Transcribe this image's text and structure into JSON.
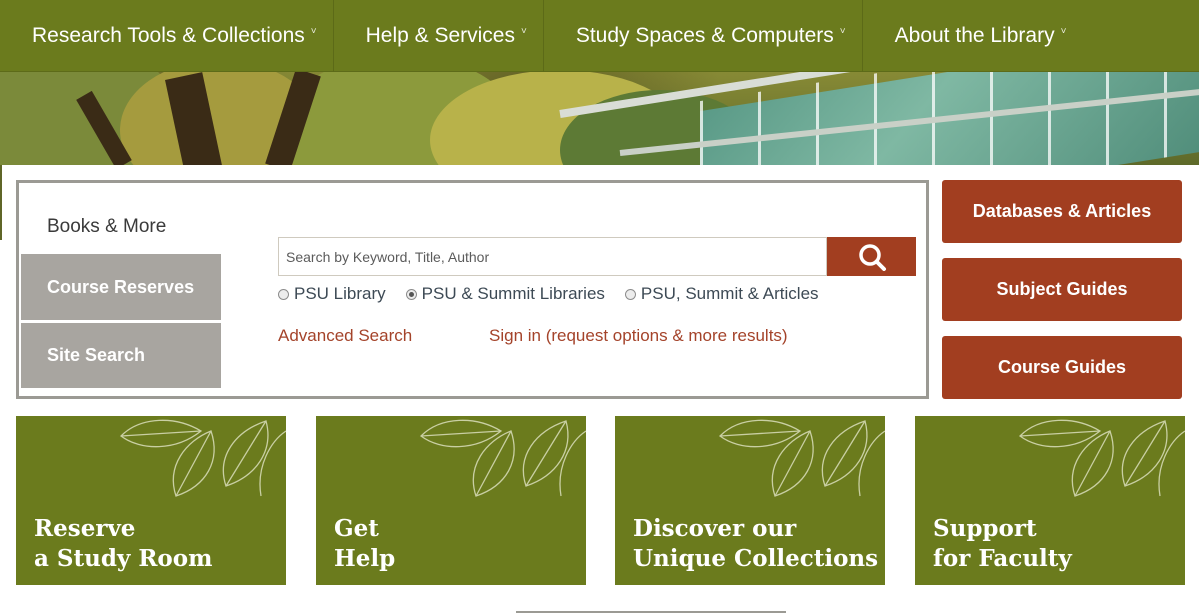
{
  "nav": {
    "items": [
      {
        "label": "Research Tools & Collections"
      },
      {
        "label": "Help & Services"
      },
      {
        "label": "Study Spaces & Computers"
      },
      {
        "label": "About the Library"
      }
    ],
    "caret": "˅"
  },
  "search": {
    "tabs": [
      {
        "label": "Books & More",
        "active": true
      },
      {
        "label": "Course Reserves",
        "active": false
      },
      {
        "label": "Site Search",
        "active": false
      }
    ],
    "placeholder": "Search by Keyword, Title, Author",
    "value": "",
    "button_icon": "search-icon",
    "scopes": [
      {
        "label": "PSU Library",
        "selected": false
      },
      {
        "label": "PSU & Summit Libraries",
        "selected": true
      },
      {
        "label": "PSU, Summit & Articles",
        "selected": false
      }
    ],
    "advanced_link": "Advanced Search",
    "signin_link": "Sign in (request options & more results)"
  },
  "quick_links": [
    {
      "label": "Databases & Articles"
    },
    {
      "label": "Subject Guides"
    },
    {
      "label": "Course Guides"
    }
  ],
  "tiles": [
    {
      "line1": "Reserve",
      "line2": "a Study Room"
    },
    {
      "line1": "Get",
      "line2": "Help"
    },
    {
      "line1": "Discover our",
      "line2": "Unique Collections"
    },
    {
      "line1": "Support",
      "line2": "for Faculty"
    }
  ],
  "colors": {
    "nav_green": "#6b7b1d",
    "accent_rust": "#a23e20",
    "tab_gray": "#a8a5a0",
    "link_rust": "#a4432a"
  }
}
